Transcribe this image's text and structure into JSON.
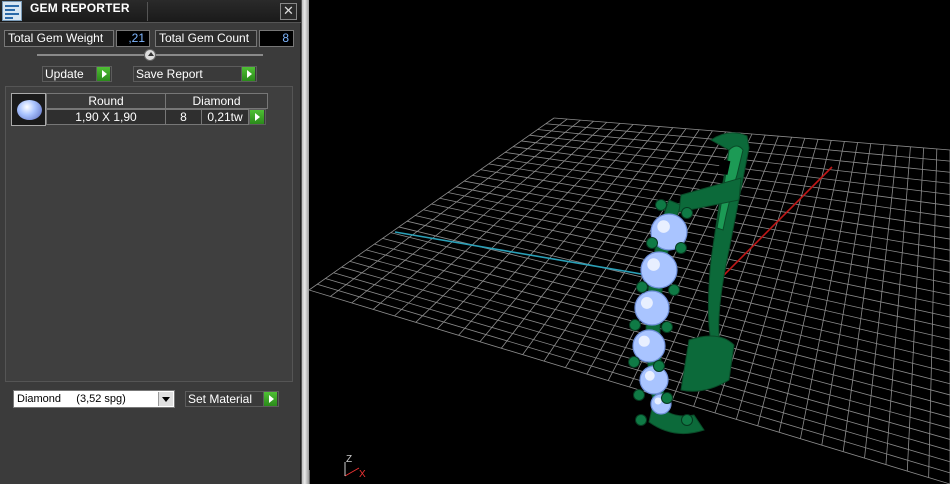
{
  "window": {
    "title": "GEM REPORTER",
    "close_glyph": "✕"
  },
  "totals": {
    "weight_label": "Total Gem Weight",
    "weight_value": ",21",
    "count_label": "Total Gem Count",
    "count_value": "8"
  },
  "buttons": {
    "update": "Update",
    "save_report": "Save Report",
    "set_material": "Set Material"
  },
  "gem_table": {
    "headers": [
      "Round",
      "Diamond"
    ],
    "rows": [
      {
        "size": "1,90 X 1,90",
        "count": "8",
        "weight": "0,21tw"
      }
    ]
  },
  "material_select": {
    "selected": "Diamond     (3,52 spg)"
  },
  "viewport": {
    "axis_labels": {
      "z": "Z",
      "x": "X"
    },
    "colors": {
      "grid": "#8c8c8c",
      "x_axis": "#c01818",
      "y_axis": "#2aa0b8",
      "metal": "#0c6a3a",
      "gems": "#a9c4ff"
    }
  }
}
